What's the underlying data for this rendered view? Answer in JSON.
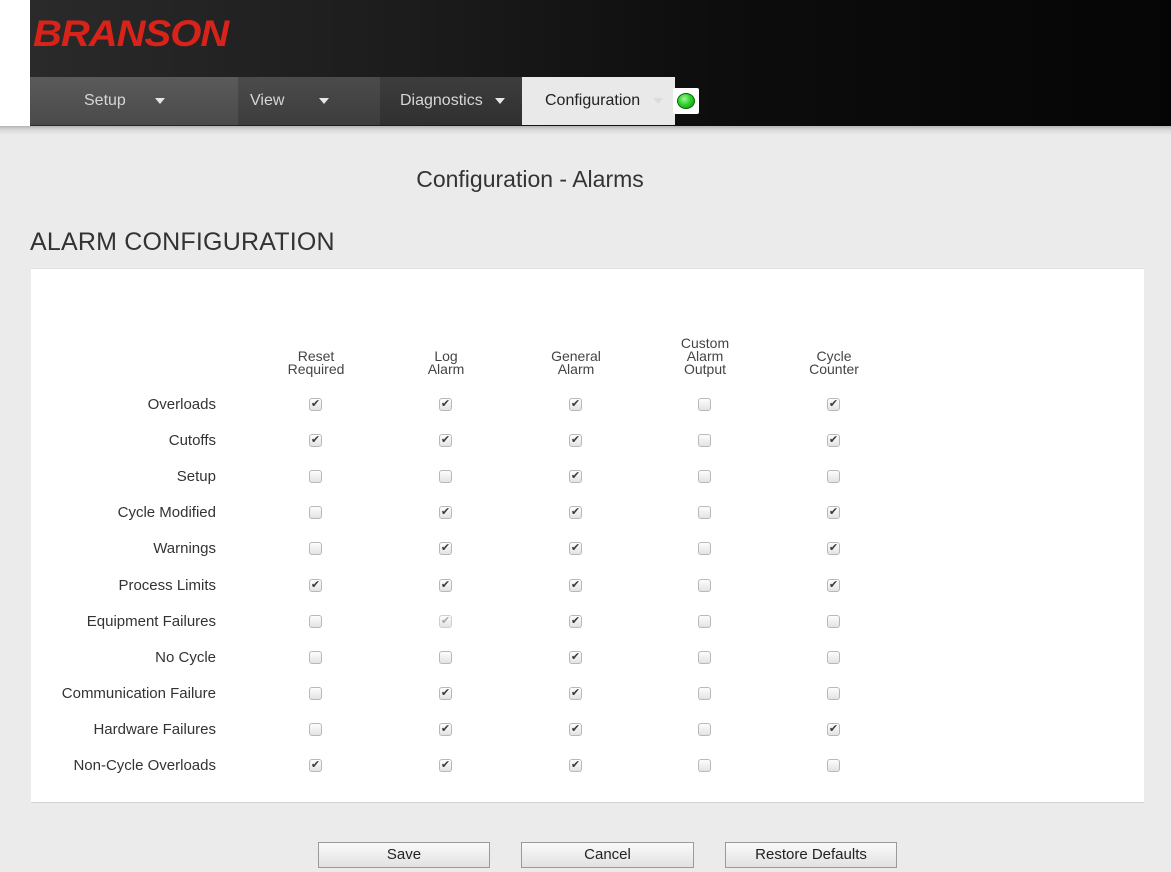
{
  "brand": {
    "logo_text": "BRANSON",
    "logo_color": "#d9231a"
  },
  "nav": {
    "items": [
      {
        "label": "Setup",
        "has_dropdown": true,
        "active": false
      },
      {
        "label": "View",
        "has_dropdown": true,
        "active": false
      },
      {
        "label": "Diagnostics",
        "has_dropdown": true,
        "active": false
      },
      {
        "label": "Configuration",
        "has_dropdown": true,
        "active": true
      }
    ],
    "status_indicator": {
      "state": "ok",
      "color": "#2fd32a"
    }
  },
  "page": {
    "title": "Configuration - Alarms",
    "section_title": "ALARM CONFIGURATION"
  },
  "alarm_table": {
    "columns": [
      {
        "lines": [
          "Reset",
          "Required"
        ]
      },
      {
        "lines": [
          "Log",
          "Alarm"
        ]
      },
      {
        "lines": [
          "General",
          "Alarm"
        ]
      },
      {
        "lines": [
          "Custom",
          "Alarm",
          "Output"
        ]
      },
      {
        "lines": [
          "Cycle",
          "Counter"
        ]
      }
    ],
    "rows": [
      {
        "label": "Overloads",
        "values": [
          true,
          true,
          true,
          false,
          true
        ],
        "disabled": [
          false,
          false,
          false,
          false,
          false
        ]
      },
      {
        "label": "Cutoffs",
        "values": [
          true,
          true,
          true,
          false,
          true
        ],
        "disabled": [
          false,
          false,
          false,
          false,
          false
        ]
      },
      {
        "label": "Setup",
        "values": [
          false,
          false,
          true,
          false,
          false
        ],
        "disabled": [
          false,
          false,
          false,
          false,
          false
        ]
      },
      {
        "label": "Cycle Modified",
        "values": [
          false,
          true,
          true,
          false,
          true
        ],
        "disabled": [
          false,
          false,
          false,
          false,
          false
        ]
      },
      {
        "label": "Warnings",
        "values": [
          false,
          true,
          true,
          false,
          true
        ],
        "disabled": [
          false,
          false,
          false,
          false,
          false
        ]
      },
      {
        "label": "Process Limits",
        "values": [
          true,
          true,
          true,
          false,
          true
        ],
        "disabled": [
          false,
          false,
          false,
          false,
          false
        ]
      },
      {
        "label": "Equipment Failures",
        "values": [
          false,
          true,
          true,
          false,
          false
        ],
        "disabled": [
          false,
          true,
          false,
          false,
          false
        ]
      },
      {
        "label": "No Cycle",
        "values": [
          false,
          false,
          true,
          false,
          false
        ],
        "disabled": [
          false,
          false,
          false,
          false,
          false
        ]
      },
      {
        "label": "Communication Failure",
        "values": [
          false,
          true,
          true,
          false,
          false
        ],
        "disabled": [
          false,
          false,
          false,
          false,
          false
        ]
      },
      {
        "label": "Hardware Failures",
        "values": [
          false,
          true,
          true,
          false,
          true
        ],
        "disabled": [
          false,
          false,
          false,
          false,
          false
        ]
      },
      {
        "label": "Non-Cycle Overloads",
        "values": [
          true,
          true,
          true,
          false,
          false
        ],
        "disabled": [
          false,
          false,
          false,
          false,
          false
        ]
      }
    ]
  },
  "buttons": {
    "save": "Save",
    "cancel": "Cancel",
    "restore_defaults": "Restore Defaults"
  }
}
